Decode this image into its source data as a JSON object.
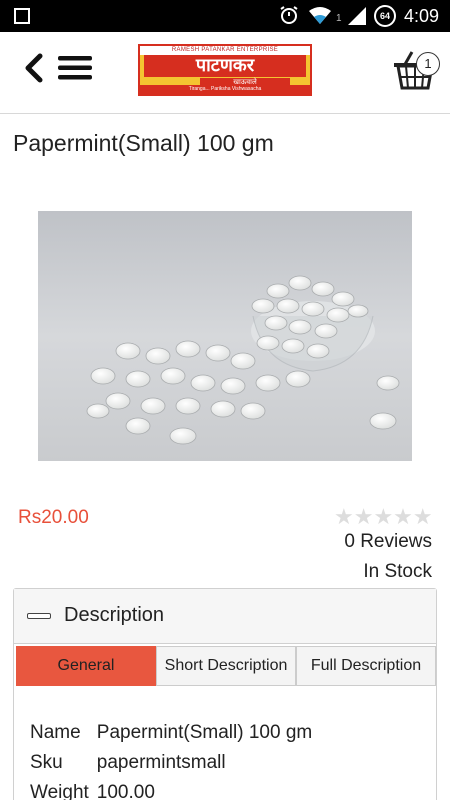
{
  "status_bar": {
    "time": "4:09",
    "battery": "64",
    "network_sub": "1"
  },
  "header": {
    "logo_top": "RAMESH PATANKAR ENTERPRISE",
    "logo_main": "पाटणकर",
    "logo_sub": "खाऊवाले",
    "logo_strip": "Tiranga... Pariksha Vishwasacha",
    "cart_count": "1"
  },
  "product": {
    "title": "Papermint(Small) 100 gm",
    "price": "Rs20.00",
    "rating": 0,
    "stars": "★★★★★",
    "reviews": "0 Reviews",
    "stock": "In Stock",
    "image_icon": "peppermint-tablets-image"
  },
  "description": {
    "label": "Description",
    "tabs": [
      {
        "label": "General",
        "active": true
      },
      {
        "label": "Short Description",
        "active": false
      },
      {
        "label": "Full Description",
        "active": false
      }
    ],
    "specs": [
      {
        "key": "Name",
        "value": "Papermint(Small) 100 gm"
      },
      {
        "key": "Sku",
        "value": "papermintsmall"
      },
      {
        "key": "Weight",
        "value": "100.00"
      }
    ]
  },
  "colors": {
    "accent": "#e8503a",
    "tab_active": "#e8573f",
    "logo_yellow": "#f4c431",
    "logo_red": "#d62e1f"
  }
}
